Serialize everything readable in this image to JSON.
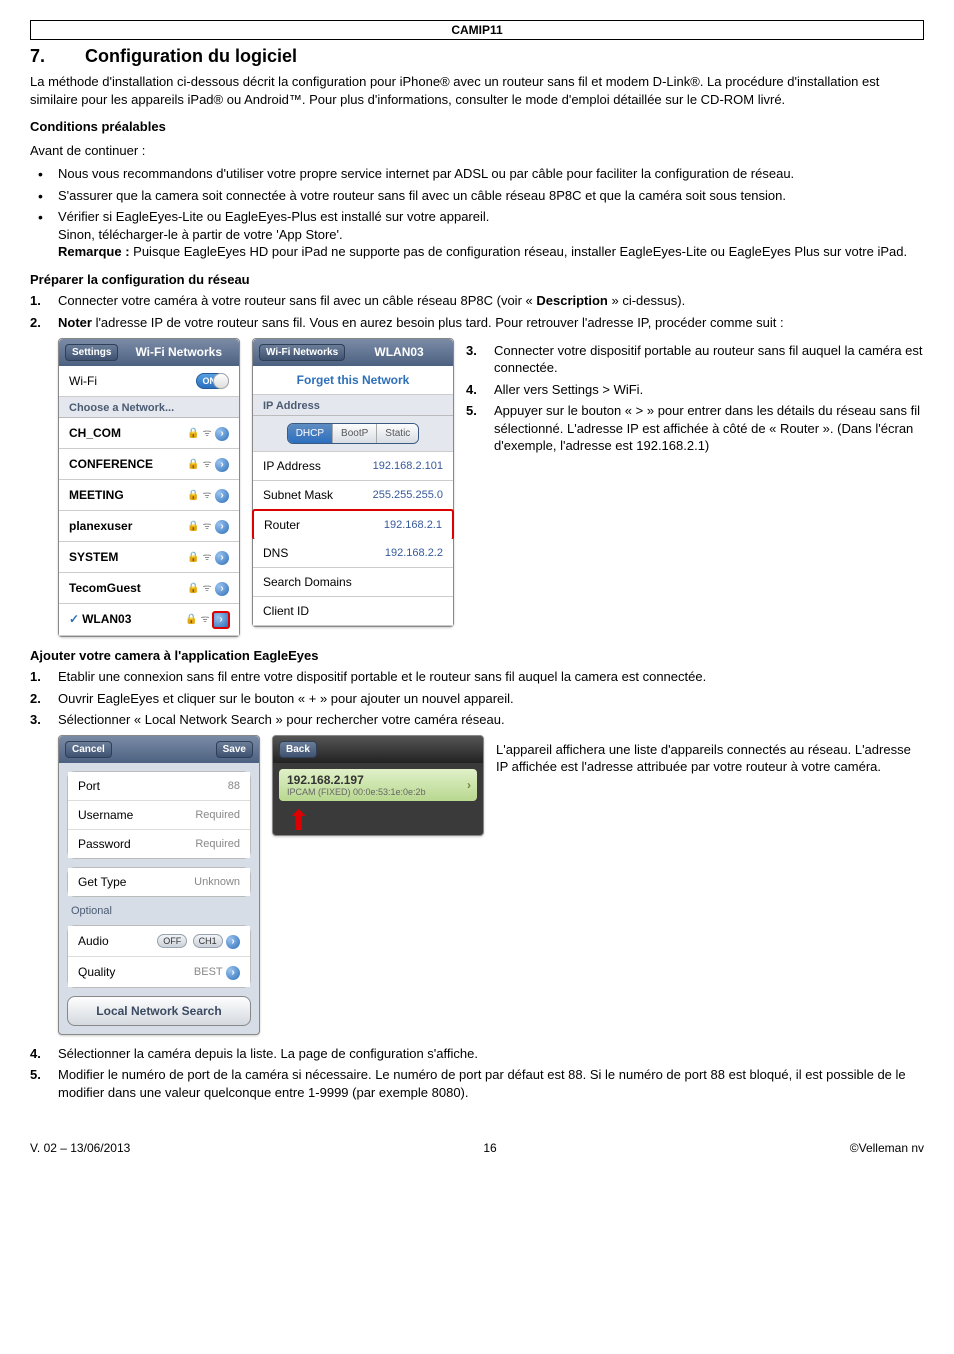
{
  "doc_header": "CAMIP11",
  "section": {
    "num": "7.",
    "title": "Configuration du logiciel"
  },
  "intro": "La méthode d'installation ci-dessous décrit la configuration pour iPhone® avec un routeur sans fil et modem D-Link®. La procédure d'installation est similaire pour les appareils iPad® ou Android™. Pour plus d'informations, consulter le mode d'emploi détaillée sur le CD-ROM livré.",
  "prereq": {
    "heading": "Conditions préalables",
    "lead": "Avant de continuer :",
    "items": [
      "Nous vous recommandons d'utiliser votre propre service internet par ADSL ou par câble pour faciliter la configuration de réseau.",
      "S'assurer que la camera soit connectée à votre routeur sans fil avec un câble réseau 8P8C et que la caméra soit sous tension.",
      "Vérifier si EagleEyes-Lite ou EagleEyes-Plus est installé sur votre appareil.\nSinon, télécharger-le à partir de votre 'App Store'.\nRemarque : Puisque EagleEyes HD pour iPad ne supporte pas de configuration réseau, installer EagleEyes-Lite ou EagleEyes Plus sur votre iPad."
    ],
    "remark_label": "Remarque :",
    "item3_line1": "Vérifier si EagleEyes-Lite ou EagleEyes-Plus est installé sur votre appareil.",
    "item3_line2": "Sinon, télécharger-le à partir de votre 'App Store'.",
    "item3_line3": "Puisque EagleEyes HD pour iPad ne supporte pas de configuration réseau, installer EagleEyes-Lite ou EagleEyes Plus sur votre iPad."
  },
  "prepare": {
    "heading": "Préparer la configuration du réseau",
    "step1_a": "Connecter votre caméra à votre routeur sans fil avec un câble réseau 8P8C (voir « ",
    "step1_b": "Description",
    "step1_c": " » ci-dessus).",
    "step2_a": "Noter",
    "step2_b": " l'adresse IP de votre routeur sans fil. Vous en aurez besoin plus tard. Pour retrouver l'adresse IP, procéder comme suit :",
    "substeps": {
      "s3": "Connecter votre dispositif portable au routeur sans fil auquel la caméra est connectée.",
      "s4": "Aller vers Settings > WiFi.",
      "s5": "Appuyer sur le bouton « > » pour entrer dans les détails du réseau sans fil sélectionné. L'adresse IP est affichée à côté de « Router ». (Dans l'écran d'exemple, l'adresse est 192.168.2.1)"
    }
  },
  "wifi_list": {
    "back": "Settings",
    "title": "Wi-Fi Networks",
    "wifi_label": "Wi-Fi",
    "on": "ON",
    "choose": "Choose a Network...",
    "networks": [
      "CH_COM",
      "CONFERENCE",
      "MEETING",
      "planexuser",
      "SYSTEM",
      "TecomGuest",
      "WLAN03"
    ],
    "selected": "WLAN03"
  },
  "wifi_detail": {
    "back": "Wi-Fi Networks",
    "title": "WLAN03",
    "forget": "Forget this Network",
    "ipaddr_head": "IP Address",
    "tabs": [
      "DHCP",
      "BootP",
      "Static"
    ],
    "rows": {
      "ip_label": "IP Address",
      "ip_val": "192.168.2.101",
      "mask_label": "Subnet Mask",
      "mask_val": "255.255.255.0",
      "router_label": "Router",
      "router_val": "192.168.2.1",
      "dns_label": "DNS",
      "dns_val": "192.168.2.2",
      "search_label": "Search Domains",
      "client_label": "Client ID"
    }
  },
  "eagle": {
    "heading": "Ajouter votre camera à l'application EagleEyes",
    "s1": "Etablir une connexion sans fil entre votre dispositif portable et le routeur sans fil auquel la camera est connectée.",
    "s2": "Ouvrir EagleEyes et cliquer sur le bouton « + » pour ajouter un nouvel appareil.",
    "s3": "Sélectionner « Local Network Search » pour rechercher votre caméra réseau.",
    "aside": "L'appareil affichera une liste d'appareils connectés au réseau. L'adresse IP affichée est l'adresse attribuée par votre routeur à votre caméra.",
    "s4": "Sélectionner la caméra depuis la liste. La page de configuration s'affiche.",
    "s5": "Modifier le numéro de port de la caméra si nécessaire. Le numéro de port par défaut est 88. Si le numéro de port 88 est bloqué, il est possible de le modifier dans une valeur quelconque entre 1-9999 (par exemple 8080)."
  },
  "form": {
    "cancel": "Cancel",
    "save": "Save",
    "port_label": "Port",
    "port_val": "88",
    "user_label": "Username",
    "user_ph": "Required",
    "pass_label": "Password",
    "pass_ph": "Required",
    "gettype_label": "Get Type",
    "gettype_val": "Unknown",
    "optional": "Optional",
    "audio_label": "Audio",
    "audio_off": "OFF",
    "audio_ch": "CH1",
    "quality_label": "Quality",
    "quality_val": "BEST",
    "search_btn": "Local Network Search"
  },
  "devlist": {
    "back": "Back",
    "ip": "192.168.2.197",
    "mac": "IPCAM (FIXED)  00:0e:53:1e:0e:2b"
  },
  "footer": {
    "left": "V. 02 – 13/06/2013",
    "center": "16",
    "right": "©Velleman nv"
  }
}
